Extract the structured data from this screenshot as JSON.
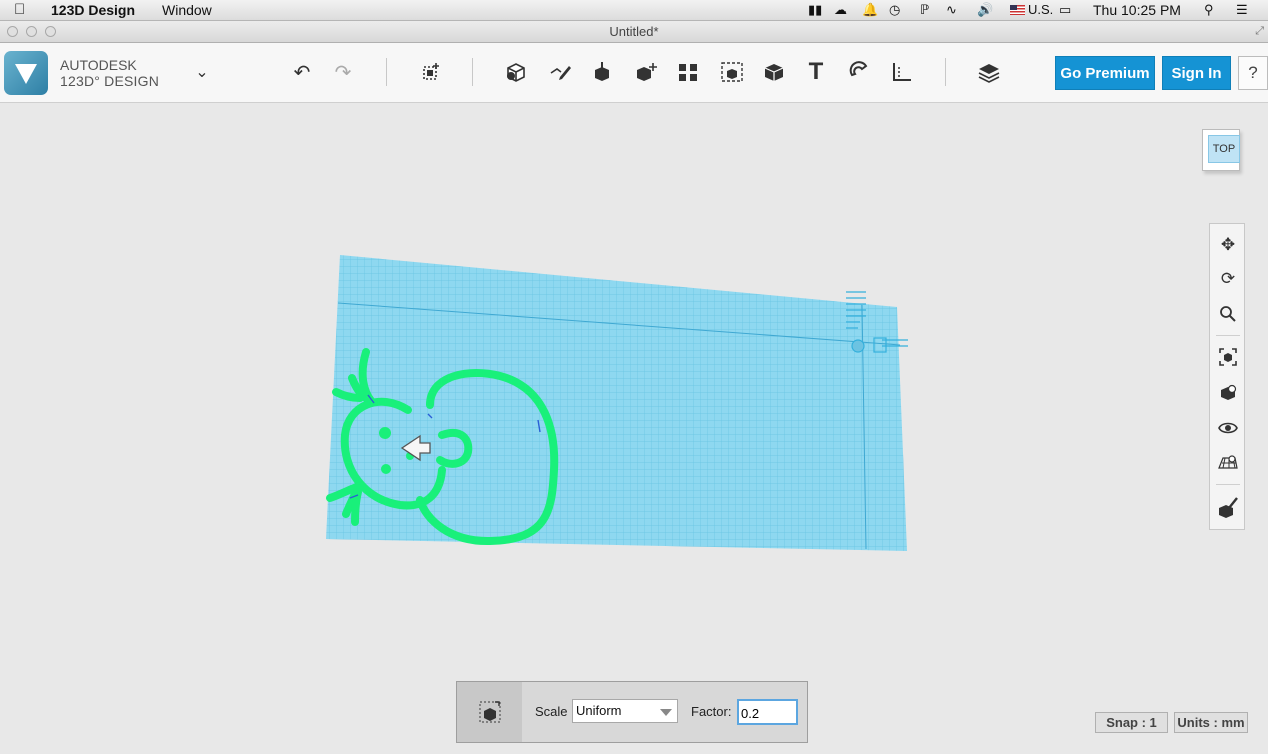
{
  "menubar": {
    "app_name": "123D Design",
    "window_menu": "Window",
    "locale": "U.S.",
    "clock": "Thu 10:25 PM"
  },
  "window": {
    "title": "Untitled*"
  },
  "brand": {
    "line1": "AUTODESK",
    "line2": "123D° DESIGN"
  },
  "toolbar": {
    "go_premium": "Go Premium",
    "sign_in": "Sign In",
    "help": "?",
    "text_tool_glyph": "T"
  },
  "viewcube": {
    "face_label": "TOP"
  },
  "scale_panel": {
    "scale_label": "Scale",
    "scale_mode": "Uniform",
    "factor_label": "Factor:",
    "factor_value": "0.2"
  },
  "status": {
    "snap": "Snap : 1",
    "units": "Units : mm"
  },
  "colors": {
    "accent": "#1593d4",
    "grid_plane": "#7fd3ee",
    "sketch_green": "#19f07a"
  }
}
